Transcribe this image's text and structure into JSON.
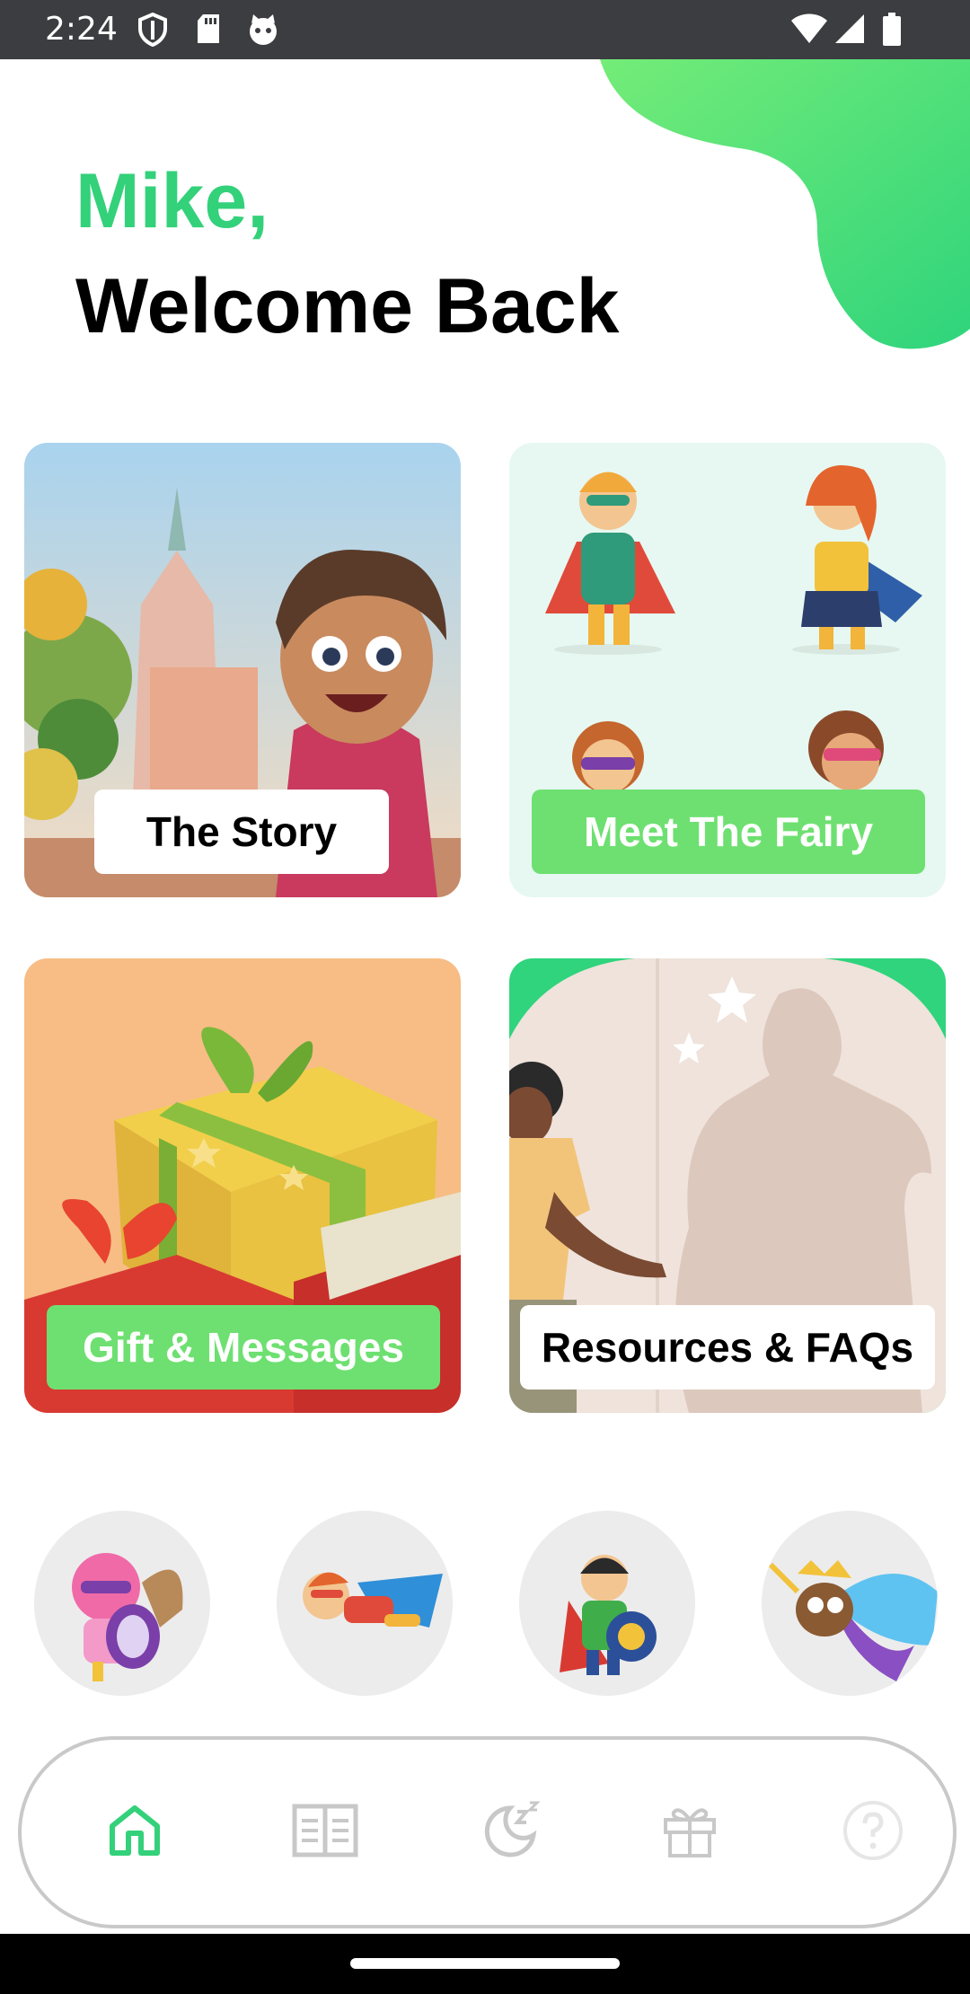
{
  "status_bar": {
    "time": "2:24"
  },
  "greeting": {
    "name": "Mike,",
    "title": "Welcome Back"
  },
  "cards": [
    {
      "label": "The Story"
    },
    {
      "label": "Meet The Fairy"
    },
    {
      "label": "Gift & Messages"
    },
    {
      "label": "Resources & FAQs"
    }
  ],
  "avatars": [
    "pink-shield-hero",
    "flying-girl-hero",
    "shield-boy-hero",
    "flying-owl-hero"
  ],
  "bottom_nav": {
    "items": [
      "home-icon",
      "book-icon",
      "moon-sleep-icon",
      "gift-icon",
      "help-icon"
    ],
    "active_index": 0
  },
  "colors": {
    "accent_green": "#33d17a",
    "label_green": "#6ee071",
    "status_bar": "#3c3d40",
    "inactive_icon": "#c8c8c8"
  }
}
